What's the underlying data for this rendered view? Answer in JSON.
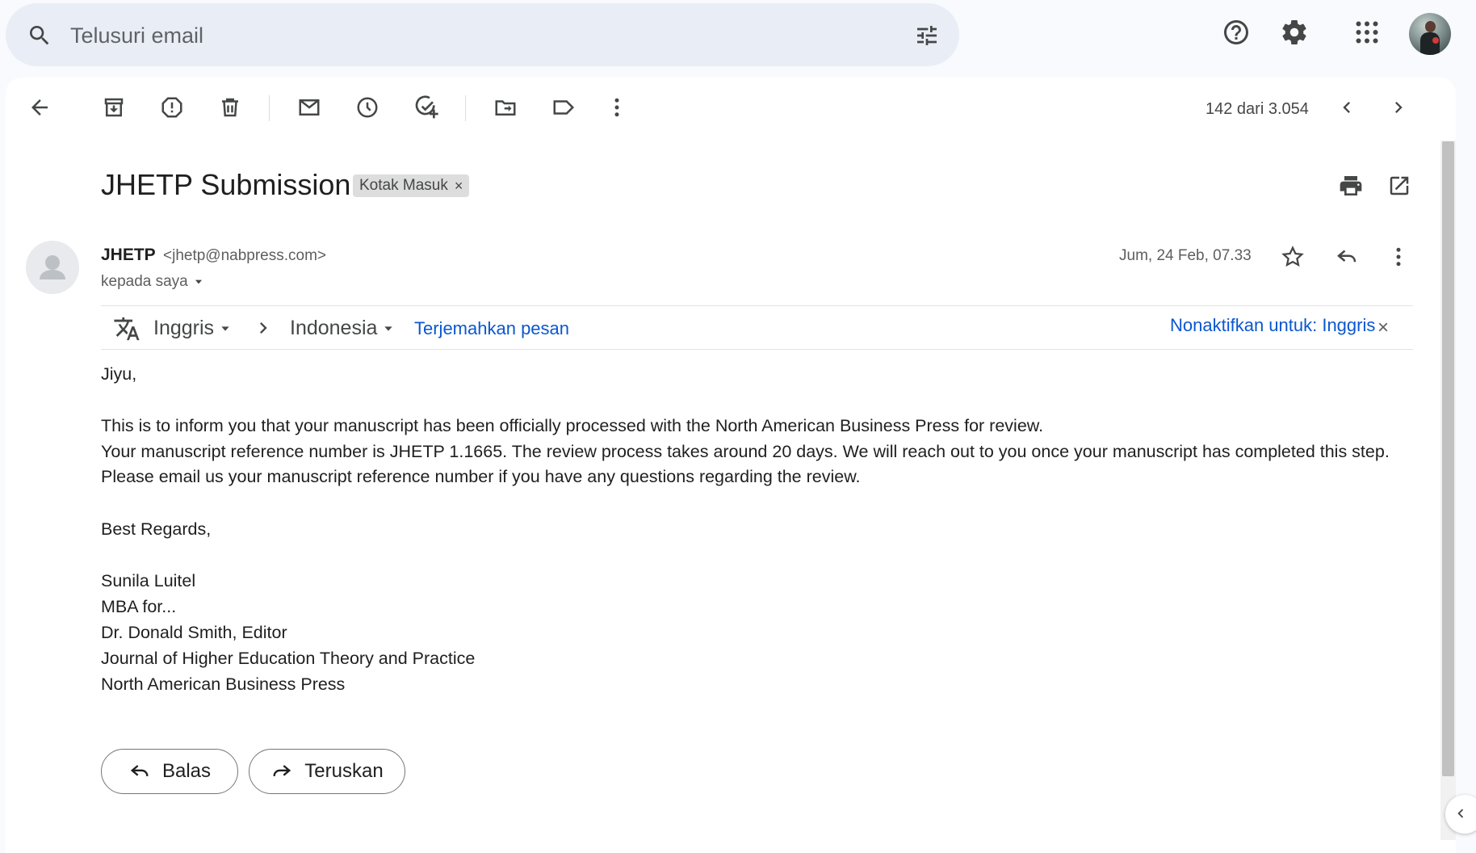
{
  "search": {
    "placeholder": "Telusuri email"
  },
  "toolbar": {
    "counter": "142 dari 3.054"
  },
  "email": {
    "subject": "JHETP Submission",
    "label": "Kotak Masuk",
    "label_close": "×",
    "sender_name": "JHETP",
    "sender_email": "<jhetp@nabpress.com>",
    "recipient": "kepada saya",
    "date": "Jum, 24 Feb, 07.33",
    "body": {
      "greeting": "Jiyu,",
      "line1": "This is to inform you that your manuscript has been officially processed with the North American Business Press for review.",
      "line2": "Your manuscript reference number is JHETP 1.1665. The review process takes around 20 days. We will reach out to you once your manuscript has completed this step.",
      "line3": "Please email us your manuscript reference number if you have any questions regarding the review.",
      "closing": "Best Regards,",
      "sig1": "Sunila Luitel",
      "sig2": "MBA for...",
      "sig3": "Dr. Donald Smith, Editor",
      "sig4": "Journal of Higher Education Theory and Practice",
      "sig5": "North American Business Press"
    }
  },
  "translate": {
    "source_lang": "Inggris",
    "target_lang": "Indonesia",
    "translate_link": "Terjemahkan pesan",
    "disable_link": "Nonaktifkan untuk: Inggris",
    "close": "×"
  },
  "actions": {
    "reply": "Balas",
    "forward": "Teruskan"
  },
  "colors": {
    "accent": "#0b57d0",
    "search_bg": "#e9eef6",
    "page_bg": "#f8fafd"
  }
}
